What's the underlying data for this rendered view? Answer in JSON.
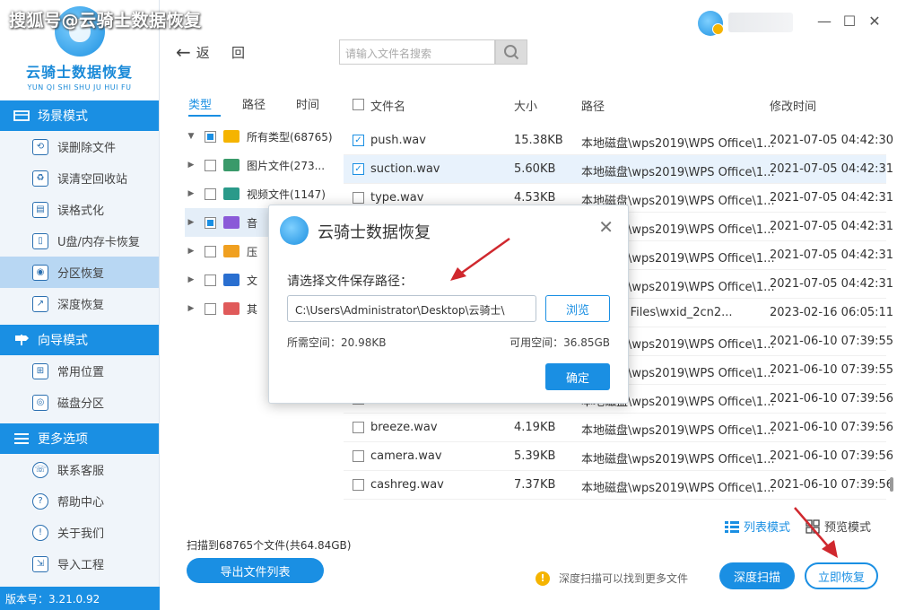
{
  "watermark": "搜狐号@云骑士数据恢复",
  "app": {
    "brand": "云骑士数据恢复",
    "brand_sub": "YUN QI SHI SHU JU HUI FU",
    "version": "版本号：3.21.0.92"
  },
  "sidebar": {
    "sections": [
      {
        "title": "场景模式",
        "items": [
          "误删除文件",
          "误清空回收站",
          "误格式化",
          "U盘/内存卡恢复",
          "分区恢复",
          "深度恢复"
        ]
      },
      {
        "title": "向导模式",
        "items": [
          "常用位置",
          "磁盘分区"
        ]
      },
      {
        "title": "更多选项",
        "items": [
          "联系客服",
          "帮助中心",
          "关于我们",
          "导入工程"
        ]
      }
    ],
    "active_item": "分区恢复"
  },
  "window_controls": {
    "min": "—",
    "max": "☐",
    "close": "✕"
  },
  "toolbar": {
    "back": "返",
    "return": "回",
    "search_placeholder": "请输入文件名搜索"
  },
  "tree": {
    "tabs": [
      "类型",
      "路径",
      "时间"
    ],
    "rows": [
      {
        "label": "所有类型(68765)",
        "expand": "▼",
        "check": "partial",
        "icon": "folder-icon",
        "color": "#f5b400"
      },
      {
        "label": "图片文件(273...",
        "expand": "▶",
        "check": "none",
        "icon": "image-icon",
        "color": "#3a9a6a"
      },
      {
        "label": "视频文件(1147)",
        "expand": "▶",
        "check": "none",
        "icon": "video-icon",
        "color": "#2a9a8a"
      },
      {
        "label": "音",
        "expand": "▶",
        "check": "partial",
        "icon": "music-icon",
        "color": "#8a5ad8"
      },
      {
        "label": "压",
        "expand": "▶",
        "check": "none",
        "icon": "zip-icon",
        "color": "#f0a020"
      },
      {
        "label": "文",
        "expand": "▶",
        "check": "none",
        "icon": "document-icon",
        "color": "#2a6fd0"
      },
      {
        "label": "其",
        "expand": "▶",
        "check": "none",
        "icon": "other-icon",
        "color": "#e05a5a"
      }
    ]
  },
  "file_list": {
    "columns": [
      "文件名",
      "大小",
      "路径",
      "修改时间"
    ],
    "rows": [
      {
        "name": "push.wav",
        "size": "15.38KB",
        "path": "本地磁盘\\wps2019\\WPS Office\\1...",
        "time": "2021-07-05 04:42:30",
        "checked": true
      },
      {
        "name": "suction.wav",
        "size": "5.60KB",
        "path": "本地磁盘\\wps2019\\WPS Office\\1...",
        "time": "2021-07-05 04:42:31",
        "checked": true
      },
      {
        "name": "type.wav",
        "size": "4.53KB",
        "path": "本地磁盘\\wps2019\\WPS Office\\1...",
        "time": "2021-07-05 04:42:31",
        "checked": false
      },
      {
        "name": "",
        "size": "",
        "path": "本地磁盘\\wps2019\\WPS Office\\1...",
        "time": "2021-07-05 04:42:31",
        "checked": false
      },
      {
        "name": "",
        "size": "",
        "path": "本地磁盘\\wps2019\\WPS Office\\1...",
        "time": "2021-07-05 04:42:31",
        "checked": false
      },
      {
        "name": "",
        "size": "",
        "path": "本地磁盘\\wps2019\\WPS Office\\1...",
        "time": "2021-07-05 04:42:31",
        "checked": false
      },
      {
        "name": "",
        "size": "",
        "path": "WeChat Files\\wxid_2cn2...",
        "time": "2023-02-16 06:05:11",
        "checked": false
      },
      {
        "name": "",
        "size": "",
        "path": "本地磁盘\\wps2019\\WPS Office\\1...",
        "time": "2021-06-10 07:39:55",
        "checked": false
      },
      {
        "name": "",
        "size": "",
        "path": "本地磁盘\\wps2019\\WPS Office\\1...",
        "time": "2021-06-10 07:39:55",
        "checked": false
      },
      {
        "name": "",
        "size": "",
        "path": "本地磁盘\\wps2019\\WPS Office\\1...",
        "time": "2021-06-10 07:39:56",
        "checked": false
      },
      {
        "name": "breeze.wav",
        "size": "4.19KB",
        "path": "本地磁盘\\wps2019\\WPS Office\\1...",
        "time": "2021-06-10 07:39:56",
        "checked": false
      },
      {
        "name": "camera.wav",
        "size": "5.39KB",
        "path": "本地磁盘\\wps2019\\WPS Office\\1...",
        "time": "2021-06-10 07:39:56",
        "checked": false
      },
      {
        "name": "cashreg.wav",
        "size": "7.37KB",
        "path": "本地磁盘\\wps2019\\WPS Office\\1...",
        "time": "2021-06-10 07:39:56",
        "checked": false
      }
    ]
  },
  "view_modes": {
    "list": "列表模式",
    "preview": "预览模式"
  },
  "bottom": {
    "scan_info": "扫描到68765个文件(共64.84GB)",
    "export": "导出文件列表",
    "tip": "深度扫描可以找到更多文件",
    "deep_scan": "深度扫描",
    "recover": "立即恢复"
  },
  "dialog": {
    "title": "云骑士数据恢复",
    "label": "请选择文件保存路径：",
    "path": "C:\\Users\\Administrator\\Desktop\\云骑士\\",
    "browse": "浏览",
    "space_needed": "所需空间：20.98KB",
    "space_available": "可用空间：36.85GB",
    "confirm": "确定"
  },
  "colors": {
    "accent": "#1a8fe3",
    "annotation": "#d0282e"
  }
}
